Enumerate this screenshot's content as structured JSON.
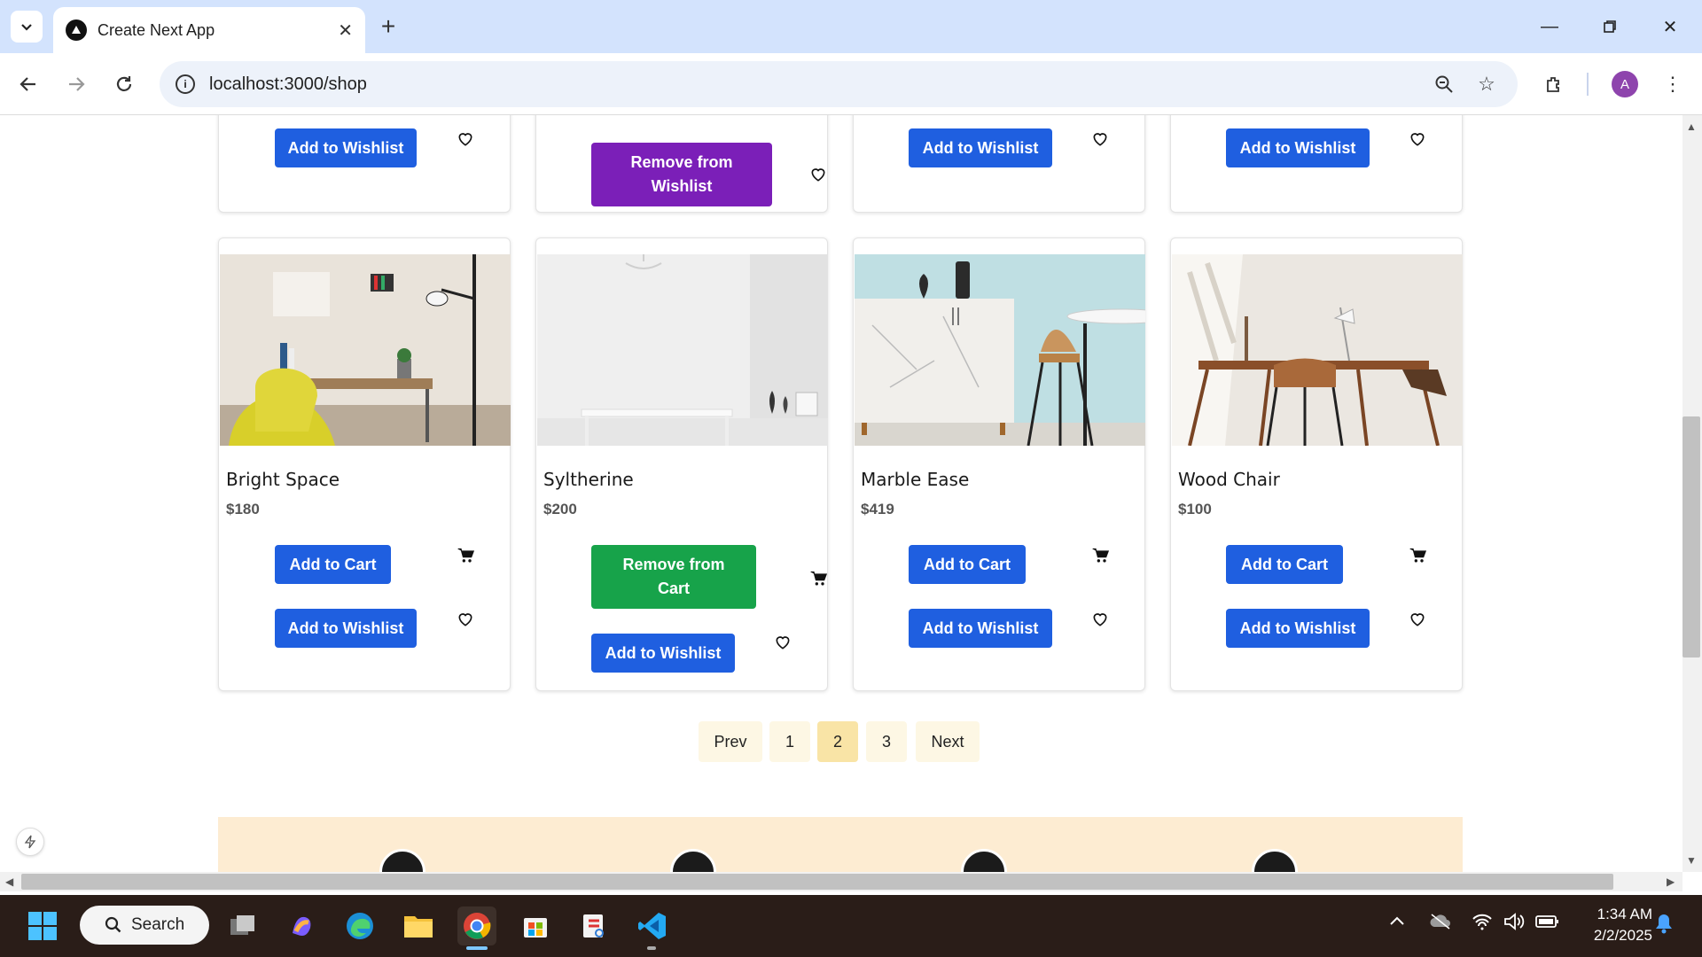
{
  "browser": {
    "tab_title": "Create Next App",
    "url": "localhost:3000/shop",
    "profile_initial": "A"
  },
  "top_row": [
    {
      "wishlist_label": "Add to Wishlist"
    },
    {
      "wishlist_label": "Remove from Wishlist"
    },
    {
      "wishlist_label": "Add to Wishlist"
    },
    {
      "wishlist_label": "Add to Wishlist"
    }
  ],
  "products": [
    {
      "name": "Bright Space",
      "price": "$180",
      "cart_label": "Add to Cart",
      "wishlist_label": "Add to Wishlist"
    },
    {
      "name": "Syltherine",
      "price": "$200",
      "cart_label": "Remove from Cart",
      "wishlist_label": "Add to Wishlist"
    },
    {
      "name": "Marble Ease",
      "price": "$419",
      "cart_label": "Add to Cart",
      "wishlist_label": "Add to Wishlist"
    },
    {
      "name": "Wood Chair",
      "price": "$100",
      "cart_label": "Add to Cart",
      "wishlist_label": "Add to Wishlist"
    }
  ],
  "pagination": {
    "prev": "Prev",
    "pages": [
      "1",
      "2",
      "3"
    ],
    "current": "2",
    "next": "Next"
  },
  "taskbar": {
    "search_label": "Search",
    "time": "1:34 AM",
    "date": "2/2/2025"
  },
  "colors": {
    "primary_button": "#1f5fe0",
    "remove_wishlist": "#7b1fb8",
    "remove_cart": "#17a34a",
    "pager_active": "#f9e4a6",
    "footer_band": "#fdecd2"
  }
}
